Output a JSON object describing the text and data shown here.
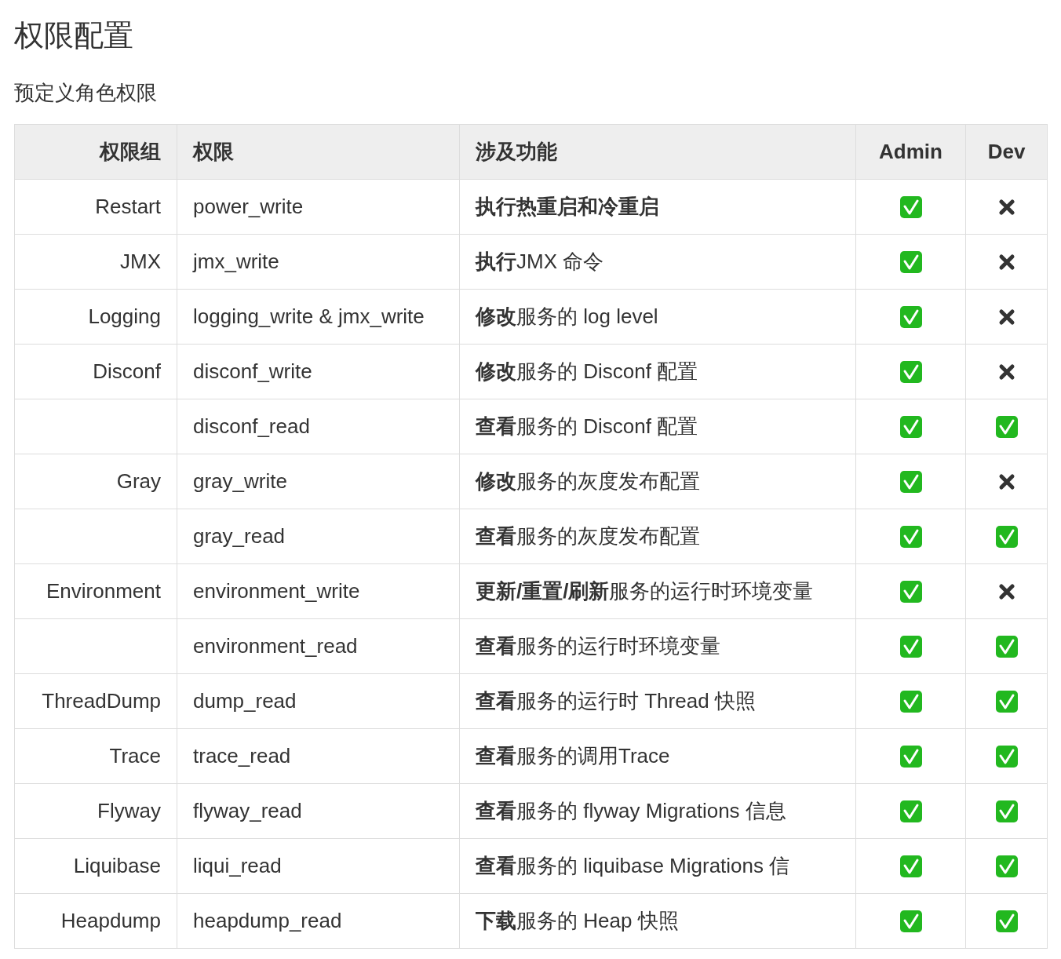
{
  "title": "权限配置",
  "subtitle": "预定义角色权限",
  "table": {
    "columns": [
      "权限组",
      "权限",
      "涉及功能",
      "Admin",
      "Dev"
    ],
    "rows": [
      {
        "group": "Restart",
        "permission": "power_write",
        "feature": "**执行热重启和冷重启**",
        "admin": true,
        "dev": false
      },
      {
        "group": "JMX",
        "permission": "jmx_write",
        "feature": "**执行**JMX 命令",
        "admin": true,
        "dev": false
      },
      {
        "group": "Logging",
        "permission": "logging_write & jmx_write",
        "feature": "**修改**服务的 log level",
        "admin": true,
        "dev": false
      },
      {
        "group": "Disconf",
        "permission": "disconf_write",
        "feature": "**修改**服务的 Disconf 配置",
        "admin": true,
        "dev": false
      },
      {
        "permission": "disconf_read",
        "feature": "**查看**服务的 Disconf 配置",
        "admin": true,
        "dev": true
      },
      {
        "group": "Gray",
        "permission": "gray_write",
        "feature": "**修改**服务的灰度发布配置",
        "admin": true,
        "dev": false
      },
      {
        "permission": "gray_read",
        "feature": "**查看**服务的灰度发布配置",
        "admin": true,
        "dev": true
      },
      {
        "group": "Environment",
        "permission": "environment_write",
        "feature": "**更新/重置/刷新**服务的运行时环境变量",
        "admin": true,
        "dev": false
      },
      {
        "permission": "environment_read",
        "feature": "**查看**服务的运行时环境变量",
        "admin": true,
        "dev": true
      },
      {
        "group": "ThreadDump",
        "permission": "dump_read",
        "feature": "**查看**服务的运行时 Thread 快照",
        "admin": true,
        "dev": true
      },
      {
        "group": "Trace",
        "permission": "trace_read",
        "feature": "**查看**服务的调用Trace",
        "admin": true,
        "dev": true
      },
      {
        "group": "Flyway",
        "permission": "flyway_read",
        "feature": "**查看**服务的 flyway Migrations 信息",
        "admin": true,
        "dev": true
      },
      {
        "group": "Liquibase",
        "permission": "liqui_read",
        "feature": "**查看**服务的 liquibase Migrations 信",
        "admin": true,
        "dev": true
      },
      {
        "group": "Heapdump",
        "permission": "heapdump_read",
        "feature": "**下载**服务的 Heap 快照",
        "admin": true,
        "dev": true
      }
    ]
  }
}
